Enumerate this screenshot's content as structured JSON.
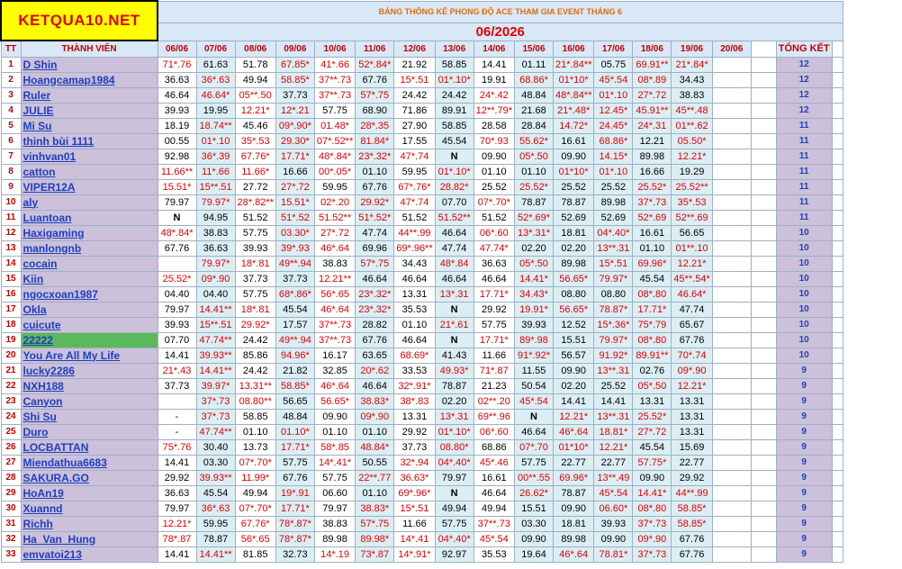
{
  "logo": "KETQUA10.NET",
  "title": "BẢNG THỐNG KÊ PHONG ĐỘ ACE THAM GIA EVENT THÁNG 6",
  "month": "06/2026",
  "headers": {
    "tt": "TT",
    "member": "THÀNH VIÊN",
    "total": "TỔNG KẾT"
  },
  "dates": [
    "06/06",
    "07/06",
    "08/06",
    "09/06",
    "10/06",
    "11/06",
    "12/06",
    "13/06",
    "14/06",
    "15/06",
    "16/06",
    "17/06",
    "18/06",
    "19/06",
    "20/06"
  ],
  "rows": [
    {
      "tt": "1",
      "name": "D Shin",
      "vals": [
        "71*.76",
        "61.63",
        "51.78",
        "67.85*",
        "41*.66",
        "52*.84*",
        "21.92",
        "58.85",
        "14.41",
        "01.11",
        "21*.84**",
        "05.75",
        "69.91**",
        "21*.84*"
      ],
      "total": "12"
    },
    {
      "tt": "2",
      "name": "Hoangcamap1984",
      "vals": [
        "36.63",
        "36*.63",
        "49.94",
        "58.85*",
        "37**.73",
        "67.76",
        "15*.51",
        "01*.10*",
        "19.91",
        "68.86*",
        "01*10*",
        "45*.54",
        "08*.89",
        "34.43"
      ],
      "total": "12"
    },
    {
      "tt": "3",
      "name": "Ruler",
      "vals": [
        "46.64",
        "46.64*",
        "05**.50",
        "37.73",
        "37**.73",
        "57*.75",
        "24.42",
        "24.42",
        "24*.42",
        "48.84",
        "48*.84**",
        "01*.10",
        "27*.72",
        "38.83"
      ],
      "total": "12"
    },
    {
      "tt": "4",
      "name": "JULIE",
      "vals": [
        "39.93",
        "19.95",
        "12.21*",
        "12*.21",
        "57.75",
        "68.90",
        "71.86",
        "89.91",
        "12**.79*",
        "21.68",
        "21*.48*",
        "12.45*",
        "45.91**",
        "45**.48"
      ],
      "total": "12"
    },
    {
      "tt": "5",
      "name": "Mi Su",
      "vals": [
        "18.19",
        "18.74**",
        "45.46",
        "09*.90*",
        "01.48*",
        "28*.35",
        "27.90",
        "58.85",
        "28.58",
        "28.84",
        "14.72*",
        "24.45*",
        "24*.31",
        "01**.62"
      ],
      "total": "11"
    },
    {
      "tt": "6",
      "name": "thinh bùi 1111",
      "vals": [
        "00.55",
        "01*.10",
        "35*.53",
        "29.30*",
        "07*.52**",
        "81.84*",
        "17.55",
        "45.54",
        "70*.93",
        "55.62*",
        "16.61",
        "68.86*",
        "12.21",
        "05.50*"
      ],
      "total": "11"
    },
    {
      "tt": "7",
      "name": "vinhvan01",
      "vals": [
        "92.98",
        "36*.39",
        "67.76*",
        "17.71*",
        "48*.84*",
        "23*.32*",
        "47*.74",
        "N",
        "09.90",
        "05*.50",
        "09.90",
        "14.15*",
        "89.98",
        "12.21*"
      ],
      "total": "11"
    },
    {
      "tt": "8",
      "name": "catton",
      "vals": [
        "11.66**",
        "11*.66",
        "11.66*",
        "16.66",
        "00*.05*",
        "01.10",
        "59.95",
        "01*.10*",
        "01.10",
        "01.10",
        "01*10*",
        "01*.10",
        "16.66",
        "19.29"
      ],
      "total": "11"
    },
    {
      "tt": "9",
      "name": "VIPER12A",
      "vals": [
        "15.51*",
        "15**.51",
        "27.72",
        "27*.72",
        "59.95",
        "67.76",
        "67*.76*",
        "28.82*",
        "25.52",
        "25.52*",
        "25.52",
        "25.52",
        "25.52*",
        "25.52**"
      ],
      "total": "11"
    },
    {
      "tt": "10",
      "name": "aly",
      "vals": [
        "79.97",
        "79.97*",
        "28*.82**",
        "15.51*",
        "02*.20",
        "29.92*",
        "47*.74",
        "07.70",
        "07*.70*",
        "78.87",
        "78.87",
        "89.98",
        "37*.73",
        "35*.53"
      ],
      "total": "11"
    },
    {
      "tt": "11",
      "name": "Luantoan",
      "vals": [
        "N",
        "94.95",
        "51.52",
        "51*.52",
        "51.52**",
        "51*.52*",
        "51.52",
        "51.52**",
        "51.52",
        "52*.69*",
        "52.69",
        "52.69",
        "52*.69",
        "52**.69"
      ],
      "total": "11"
    },
    {
      "tt": "12",
      "name": "Haxigaming",
      "vals": [
        "48*.84*",
        "38.83",
        "57.75",
        "03.30*",
        "27*.72",
        "47.74",
        "44**.99",
        "46.64",
        "06*.60",
        "13*.31*",
        "18.81",
        "04*.40*",
        "16.61",
        "56.65"
      ],
      "total": "10"
    },
    {
      "tt": "13",
      "name": "manlongnb",
      "vals": [
        "67.76",
        "36.63",
        "39.93",
        "39*.93",
        "46*.64",
        "69.96",
        "69*.96**",
        "47.74",
        "47.74*",
        "02.20",
        "02.20",
        "13**.31",
        "01.10",
        "01**.10"
      ],
      "total": "10"
    },
    {
      "tt": "14",
      "name": "cocain",
      "vals": [
        "",
        "79.97*",
        "18*.81",
        "49**.94",
        "38.83",
        "57*.75",
        "34.43",
        "48*.84",
        "36.63",
        "05*.50",
        "89.98",
        "15*.51",
        "69.96*",
        "12.21*"
      ],
      "total": "10"
    },
    {
      "tt": "15",
      "name": "Kiin",
      "vals": [
        "25.52*",
        "09*.90",
        "37.73",
        "37.73",
        "12.21**",
        "46.64",
        "46.64",
        "46.64",
        "46.64",
        "14.41*",
        "56.65*",
        "79.97*",
        "45.54",
        "45**.54*"
      ],
      "total": "10"
    },
    {
      "tt": "16",
      "name": "ngocxoan1987",
      "vals": [
        "04.40",
        "04.40",
        "57.75",
        "68*.86*",
        "56*.65",
        "23*.32*",
        "13.31",
        "13*.31",
        "17.71*",
        "34.43*",
        "08.80",
        "08.80",
        "08*.80",
        "46.64*"
      ],
      "total": "10"
    },
    {
      "tt": "17",
      "name": "Okla",
      "vals": [
        "79.97",
        "14.41**",
        "18*.81",
        "45.54",
        "46*.64",
        "23*.32*",
        "35.53",
        "N",
        "29.92",
        "19.91*",
        "56.65*",
        "78.87*",
        "17.71*",
        "47.74"
      ],
      "total": "10"
    },
    {
      "tt": "18",
      "name": "cuicute",
      "vals": [
        "39.93",
        "15**.51",
        "29.92*",
        "17.57",
        "37**.73",
        "28.82",
        "01.10",
        "21*.61",
        "57.75",
        "39.93",
        "12.52",
        "15*.36*",
        "75*.79",
        "65.67"
      ],
      "total": "10"
    },
    {
      "tt": "19",
      "name": "22222",
      "vals": [
        "07.70",
        "47.74**",
        "24.42",
        "49**.94",
        "37**.73",
        "67.76",
        "46.64",
        "N",
        "17.71*",
        "89*.98",
        "15.51",
        "79.97*",
        "08*.80",
        "67.76"
      ],
      "total": "10"
    },
    {
      "tt": "20",
      "name": "You Are All My Life",
      "vals": [
        "14.41",
        "39.93**",
        "85.86",
        "94.96*",
        "16.17",
        "63.65",
        "68.69*",
        "41.43",
        "11.66",
        "91*.92*",
        "56.57",
        "91.92*",
        "89.91**",
        "70*.74"
      ],
      "total": "10"
    },
    {
      "tt": "21",
      "name": "lucky2286",
      "vals": [
        "21*.43",
        "14.41**",
        "24.42",
        "21.82",
        "32.85",
        "20*.62",
        "33.53",
        "49.93*",
        "71*.87",
        "11.55",
        "09.90",
        "13**.31",
        "02.76",
        "09*.90"
      ],
      "total": "9"
    },
    {
      "tt": "22",
      "name": "NXH188",
      "vals": [
        "37.73",
        "39.97*",
        "13.31**",
        "58.85*",
        "46*.64",
        "46.64",
        "32*.91*",
        "78.87",
        "21.23",
        "50.54",
        "02.20",
        "25.52",
        "05*.50",
        "12.21*"
      ],
      "total": "9"
    },
    {
      "tt": "23",
      "name": "Canyon",
      "vals": [
        "",
        "37*.73",
        "08.80**",
        "56.65",
        "56.65*",
        "38.83*",
        "38*.83",
        "02.20",
        "02**.20",
        "45*.54",
        "14.41",
        "14.41",
        "13.31",
        "13.31"
      ],
      "total": "9"
    },
    {
      "tt": "24",
      "name": "Shi Su",
      "vals": [
        "-",
        "37*.73",
        "58.85",
        "48.84",
        "09.90",
        "09*.90",
        "13.31",
        "13*.31",
        "69**.96",
        "N",
        "12.21*",
        "13**.31",
        "25.52*",
        "13.31"
      ],
      "total": "9"
    },
    {
      "tt": "25",
      "name": "Duro",
      "vals": [
        "-",
        "47.74**",
        "01.10",
        "01.10*",
        "01.10",
        "01.10",
        "29.92",
        "01*.10*",
        "06*.60",
        "46.64",
        "46*.64",
        "18.81*",
        "27*.72",
        "13.31"
      ],
      "total": "9"
    },
    {
      "tt": "26",
      "name": "LOCBATTAN",
      "vals": [
        "75*.76",
        "30.40",
        "13.73",
        "17.71*",
        "58*.85",
        "48.84*",
        "37.73",
        "08.80*",
        "68.86",
        "07*.70",
        "01*10*",
        "12.21*",
        "45.54",
        "15.69"
      ],
      "total": "9"
    },
    {
      "tt": "27",
      "name": "Miendathua6683",
      "vals": [
        "14.41",
        "03.30",
        "07*.70*",
        "57.75",
        "14*.41*",
        "50.55",
        "32*.94",
        "04*.40*",
        "45*.46",
        "57.75",
        "22.77",
        "22.77",
        "57.75*",
        "22.77"
      ],
      "total": "9"
    },
    {
      "tt": "28",
      "name": "SAKURA.GO",
      "vals": [
        "29.92",
        "39.93**",
        "11.99*",
        "67.76",
        "57.75",
        "22**.77",
        "36.63*",
        "79.97",
        "16.61",
        "00**.55",
        "69.96*",
        "13**.49",
        "09.90",
        "29.92"
      ],
      "total": "9"
    },
    {
      "tt": "29",
      "name": "HoAn19",
      "vals": [
        "36.63",
        "45.54",
        "49.94",
        "19*.91",
        "06.60",
        "01.10",
        "69*.96*",
        "N",
        "46.64",
        "26.62*",
        "78.87",
        "45*.54",
        "14.41*",
        "44**.99"
      ],
      "total": "9"
    },
    {
      "tt": "30",
      "name": "Xuannd",
      "vals": [
        "79.97",
        "36*.63",
        "07*.70*",
        "17.71*",
        "79.97",
        "38.83*",
        "15*.51",
        "49.94",
        "49.94",
        "15.51",
        "09.90",
        "06.60*",
        "08*.80",
        "58.85*"
      ],
      "total": "9"
    },
    {
      "tt": "31",
      "name": "Richh",
      "vals": [
        "12.21*",
        "59.95",
        "67.76*",
        "78*.87*",
        "38.83",
        "57*.75",
        "11.66",
        "57.75",
        "37**.73",
        "03.30",
        "18.81",
        "39.93",
        "37*.73",
        "58.85*"
      ],
      "total": "9"
    },
    {
      "tt": "32",
      "name": "Ha_Van_Hung",
      "vals": [
        "78*.87",
        "78.87",
        "56*.65",
        "78*.87*",
        "89.98",
        "89.98*",
        "14*.41",
        "04*.40*",
        "45*.54",
        "09.90",
        "89.98",
        "09.90",
        "09*.90",
        "67.76"
      ],
      "total": "9"
    },
    {
      "tt": "33",
      "name": "emvatoi213",
      "vals": [
        "14.41",
        "14.41**",
        "81.85",
        "32.73",
        "14*.19",
        "73*.87",
        "14*.91*",
        "92.97",
        "35.53",
        "19.64",
        "46*.64",
        "78.81*",
        "37*.73",
        "67.76"
      ],
      "total": "9"
    }
  ]
}
